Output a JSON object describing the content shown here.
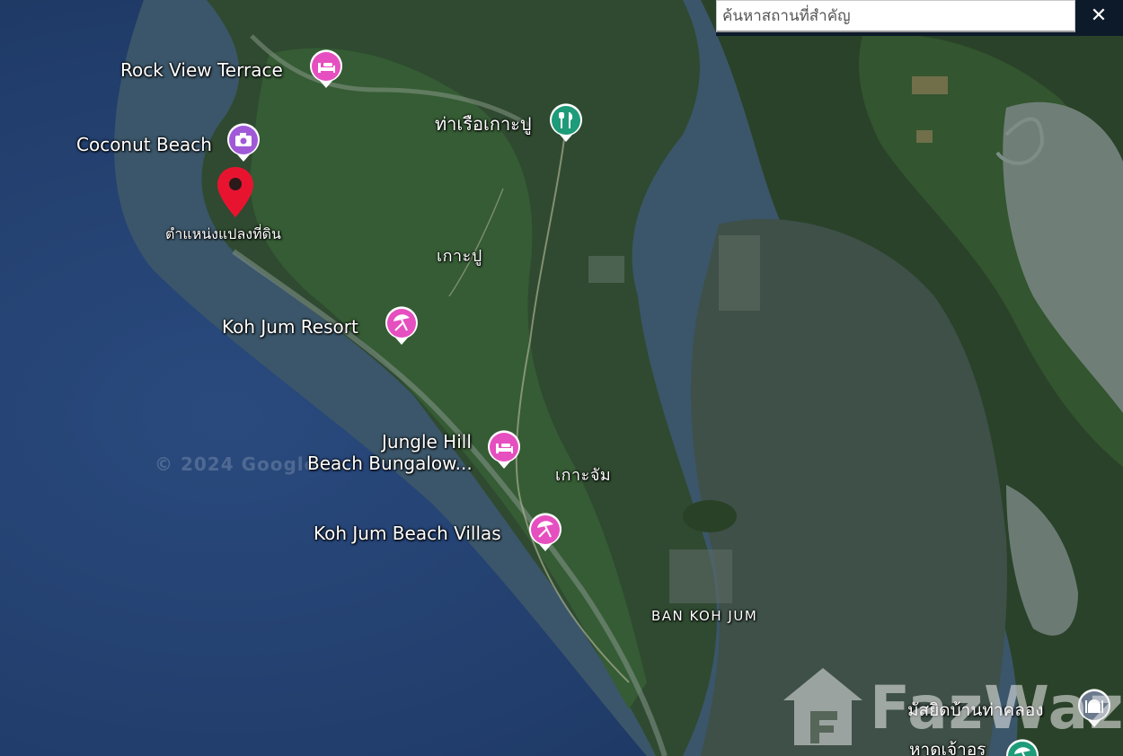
{
  "search": {
    "placeholder": "ค้นหาสถานที่สำคัญ",
    "close_label": "✕"
  },
  "map": {
    "copyright": "© 2024 Google",
    "watermark": "FazWaz",
    "land_plot_label": "ตำแหน่งแปลงที่ดิน",
    "areas": {
      "koh_pu": "เกาะปู",
      "koh_jum": "เกาะจัม",
      "ban_koh_jum": "BAN KOH JUM"
    },
    "pois": [
      {
        "name": "Rock View Terrace",
        "icon": "hotel-icon",
        "color": "#e64fbf"
      },
      {
        "name": "Coconut Beach",
        "icon": "camera-icon",
        "color": "#a05ad8"
      },
      {
        "name": "ท่าเรือเกาะปู",
        "icon": "restaurant-icon",
        "color": "#1e9b78"
      },
      {
        "name": "Koh Jum Resort",
        "icon": "beach-icon",
        "color": "#e64fbf"
      },
      {
        "name_line1": "Jungle Hill",
        "name_line2": "Beach Bungalow...",
        "icon": "hotel-icon",
        "color": "#e64fbf"
      },
      {
        "name": "Koh Jum Beach Villas",
        "icon": "beach-icon",
        "color": "#e64fbf"
      },
      {
        "name": "มัสยิดบ้านท่าคลอง",
        "icon": "mosque-icon",
        "color": "#6b7a8c"
      },
      {
        "name": "หาดเจ้าอร",
        "icon": "beach-icon",
        "color": "#1e9b78"
      }
    ],
    "marker_color": "#e8142f"
  }
}
